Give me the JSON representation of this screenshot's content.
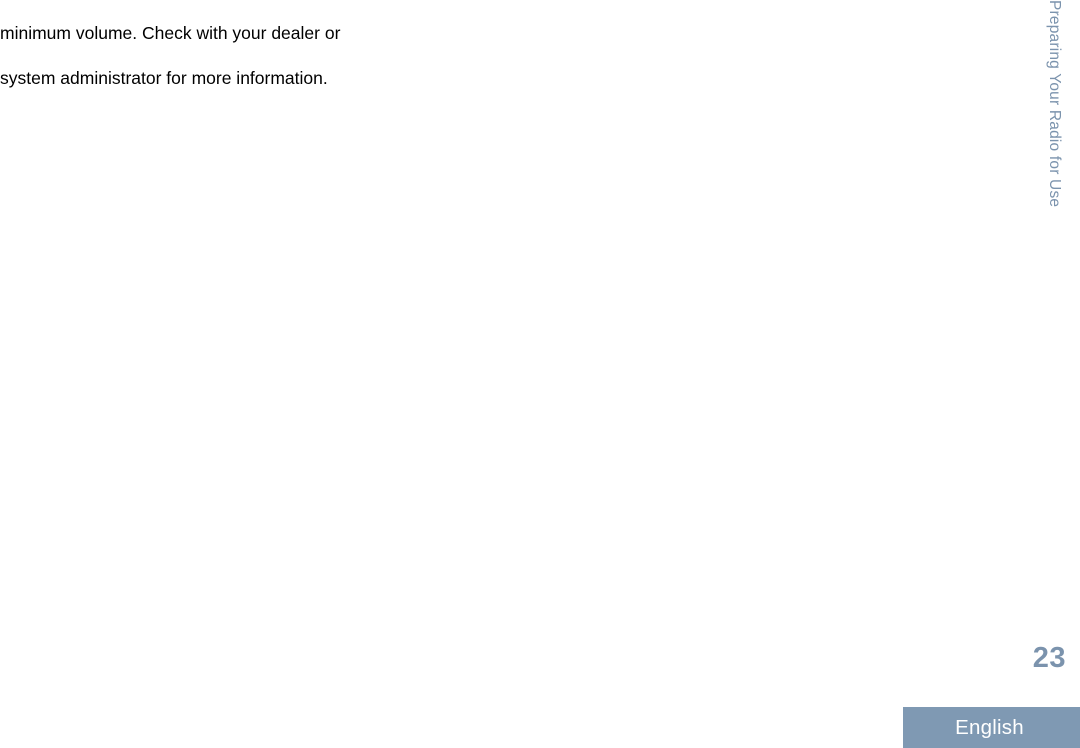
{
  "document": {
    "page_background": "#ffffff",
    "accent_color": "#7b93ad",
    "footer_bar_color": "#7f99b3",
    "body_text_color": "#000000"
  },
  "body": {
    "paragraph_lines": [
      "minimum volume. Check with your dealer or",
      "system administrator for more information."
    ],
    "line_1": "minimum volume. Check with your dealer or",
    "line_2": "system administrator for more information."
  },
  "side_tab": {
    "chapter_title": "Preparing Your Radio for Use"
  },
  "footer": {
    "page_number": "23",
    "language": "English"
  }
}
